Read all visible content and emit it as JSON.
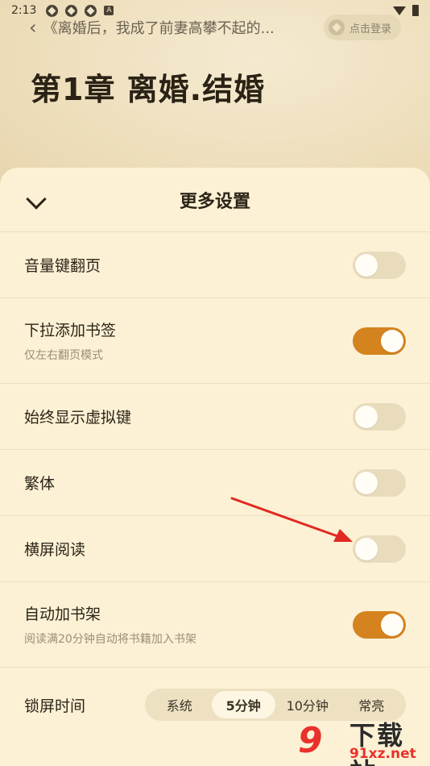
{
  "status_bar": {
    "time": "2:13",
    "badge": "A"
  },
  "top_nav": {
    "book_title": "《离婚后，我成了前妻高攀不起的...",
    "login_label": "点击登录"
  },
  "chapter": {
    "title": "第1章 离婚.结婚"
  },
  "sheet": {
    "title": "更多设置",
    "rows": [
      {
        "label": "音量键翻页",
        "sub": "",
        "on": false
      },
      {
        "label": "下拉添加书签",
        "sub": "仅左右翻页模式",
        "on": true
      },
      {
        "label": "始终显示虚拟键",
        "sub": "",
        "on": false
      },
      {
        "label": "繁体",
        "sub": "",
        "on": false
      },
      {
        "label": "横屏阅读",
        "sub": "",
        "on": false
      },
      {
        "label": "自动加书架",
        "sub": "阅读满20分钟自动将书籍加入书架",
        "on": true
      }
    ],
    "lock_screen": {
      "label": "锁屏时间",
      "options": [
        "系统",
        "5分钟",
        "10分钟",
        "常亮"
      ],
      "selected": "5分钟"
    }
  },
  "colors": {
    "accent": "#d4831e",
    "sheet_bg": "#fcf1d5",
    "annotation": "#e02a22"
  },
  "watermark": {
    "logo_text": "9",
    "name": "下载站",
    "url": "91xz.net"
  }
}
